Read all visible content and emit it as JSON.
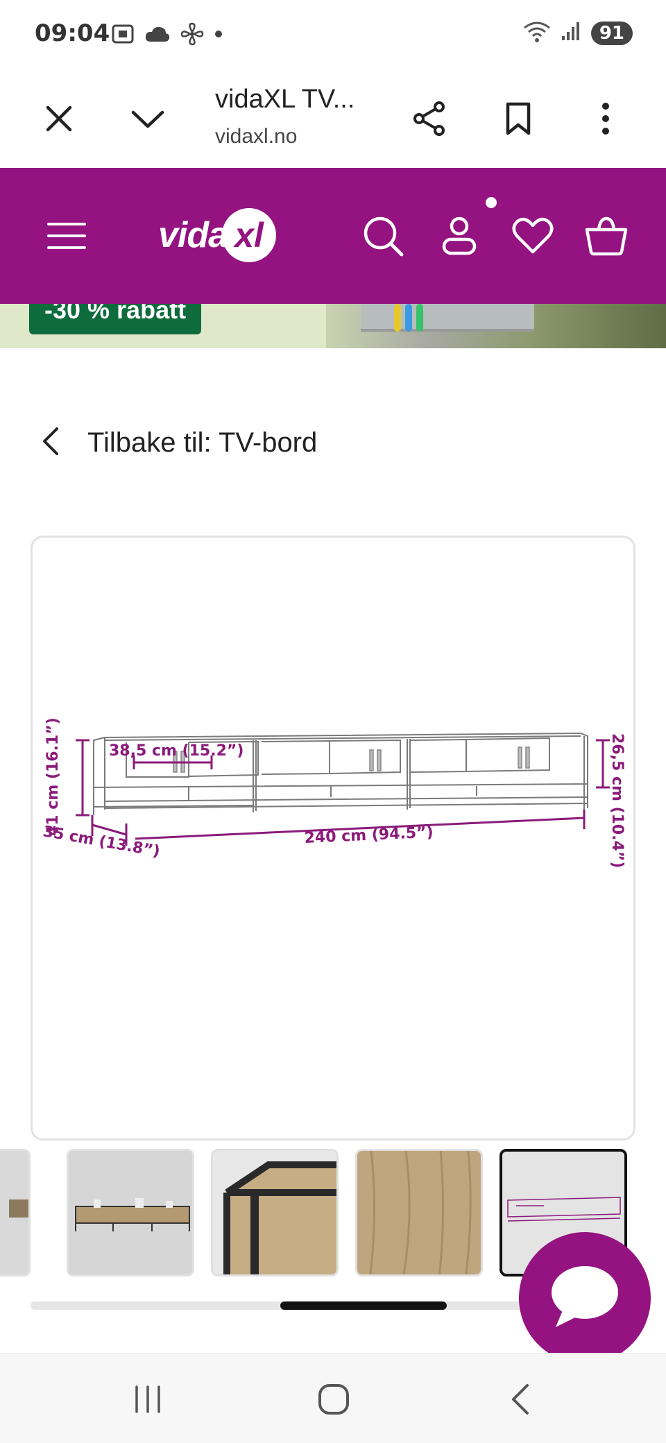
{
  "status_bar": {
    "time": "09:04",
    "battery": "91",
    "icons_left": [
      "screenshot-icon",
      "cloud-icon",
      "fan-icon",
      "dot-icon"
    ],
    "icons_right": [
      "wifi-icon",
      "signal-icon",
      "battery-icon"
    ]
  },
  "browser": {
    "title": "vidaXL TV...",
    "domain": "vidaxl.no"
  },
  "header": {
    "logo_text": "vida",
    "logo_mark": "xl",
    "brand_color": "#941380"
  },
  "promo": {
    "badge": "-30 % rabatt",
    "badge_color": "#0d6b3c"
  },
  "back_link": {
    "label": "Tilbake til: TV-bord"
  },
  "product_image": {
    "dimension_height": "41 cm (16.1”)",
    "dimension_depth": "35 cm (13.8”)",
    "dimension_width": "240 cm (94.5”)",
    "dimension_compartment": "38,5 cm (15.2”)",
    "dimension_cabinet_height": "26,5 cm (10.4”)"
  },
  "thumbnails": [
    {
      "name": "thumb-partial"
    },
    {
      "name": "thumb-front-view"
    },
    {
      "name": "thumb-corner-detail"
    },
    {
      "name": "thumb-wood-texture"
    },
    {
      "name": "thumb-dimensions",
      "active": true
    }
  ],
  "scroll_progress": 0.62
}
